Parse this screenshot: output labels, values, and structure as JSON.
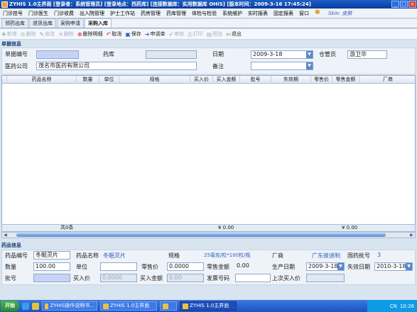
{
  "window": {
    "title": "ZYHIS 1.0主界面  [登录者：系统管理员]  [登录地点：西药库]  [连接数据库：实用数据库 OHIS]  [版本时间：2009-3-16 17:45:24]",
    "buttons": [
      "_",
      "□",
      "×"
    ]
  },
  "menu": {
    "items": [
      "门诊挂号",
      "门诊医生",
      "门诊收费",
      "出入院管理",
      "护士工作站",
      "药房管理",
      "药库管理",
      "体检与检验",
      "系统维护",
      "实时报表",
      "固定报表",
      "窗口"
    ],
    "skin_label": "Skin: 皮肤"
  },
  "tabs": [
    "领药出库",
    "退货出库",
    "采购申请",
    "采购入库"
  ],
  "toolbar": [
    {
      "label": "新增",
      "icon": "+",
      "disabled": true
    },
    {
      "label": "删除",
      "icon": "−",
      "disabled": true
    },
    {
      "label": "修改",
      "icon": "✎",
      "disabled": true
    },
    {
      "label": "删除",
      "icon": "✕",
      "disabled": true
    },
    {
      "label": "删除明细",
      "icon": "✖",
      "disabled": false
    },
    {
      "label": "取消",
      "icon": "↶",
      "disabled": false
    },
    {
      "label": "保存",
      "icon": "▣",
      "disabled": false
    },
    {
      "label": "申请单",
      "icon": "⇨",
      "disabled": false
    },
    {
      "label": "审核",
      "icon": "✔",
      "disabled": true
    },
    {
      "label": "打印",
      "icon": "⎙",
      "disabled": true
    },
    {
      "label": "预览",
      "icon": "▤",
      "disabled": true
    },
    {
      "label": "退出",
      "icon": "⇦",
      "disabled": false
    }
  ],
  "doc_section": {
    "title": "单据信息",
    "fields": {
      "doc_no_label": "单据编号",
      "doc_no_value": "",
      "warehouse_label": "药库",
      "warehouse_value": "",
      "date_label": "日期",
      "date_value": "2009-3-18",
      "keeper_label": "仓管员",
      "keeper_value": "游卫华",
      "company_label": "医药公司",
      "company_value": "茂名市医药有限公司",
      "remark_label": "备注",
      "remark_value": ""
    }
  },
  "grid": {
    "columns": [
      "药品名称",
      "数量",
      "单位",
      "规格",
      "买入价",
      "买入金额",
      "批号",
      "失效期",
      "零售价",
      "零售金额",
      "厂商"
    ],
    "rows": [],
    "summary_count": "共0条",
    "summary_buy_amount": "¥ 0.00",
    "summary_sell_amount": "¥ 0.00"
  },
  "drug_section": {
    "title": "药品信息",
    "code_label": "药品编号",
    "code_value": "冬眠灵片",
    "name_label": "药品名称",
    "name_value": "冬眠灵片",
    "spec_label": "规格",
    "spec_value": "25毫克/粒*100粒/瓶",
    "maker_label": "厂商",
    "maker_value": "广东彼迪制",
    "approval_label": "国药批号",
    "approval_value": "3",
    "qty_label": "数量",
    "qty_value": "100.00",
    "unit_label": "单位",
    "unit_value": "",
    "price_label": "零售价",
    "price_value": "0.0000",
    "sell_amount_label": "零售金额",
    "sell_amount_value": "0.00",
    "prod_date_label": "生产日期",
    "prod_date_value": "2009-3-18",
    "expire_label": "失效日期",
    "expire_value": "2010-3-18",
    "batch_label": "批号",
    "batch_value": "",
    "buy_price_label": "买入价",
    "buy_price_value": "0.0000",
    "buy_amount_label": "买入金额",
    "buy_amount_value": "0.00",
    "invoice_label": "发票号码",
    "invoice_value": "",
    "last_price_label": "上次买入价",
    "last_price_value": ""
  },
  "taskbar": {
    "start": "开始",
    "tasks": [
      "ZYHIS操作说明书...",
      "ZYHIS 1.0主界面",
      "",
      "ZYHIS 1.0主界面"
    ],
    "clock": "10:26",
    "ime": "CN"
  }
}
